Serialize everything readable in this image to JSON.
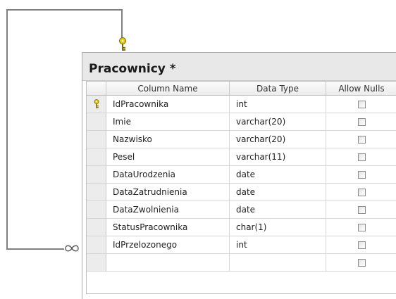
{
  "table": {
    "title": "Pracownicy *",
    "headers": {
      "name": "Column Name",
      "type": "Data Type",
      "nulls": "Allow Nulls"
    },
    "rows": [
      {
        "name": "IdPracownika",
        "type": "int",
        "allow_nulls": false,
        "primary_key": true
      },
      {
        "name": "Imie",
        "type": "varchar(20)",
        "allow_nulls": false,
        "primary_key": false
      },
      {
        "name": "Nazwisko",
        "type": "varchar(20)",
        "allow_nulls": false,
        "primary_key": false
      },
      {
        "name": "Pesel",
        "type": "varchar(11)",
        "allow_nulls": false,
        "primary_key": false
      },
      {
        "name": "DataUrodzenia",
        "type": "date",
        "allow_nulls": false,
        "primary_key": false
      },
      {
        "name": "DataZatrudnienia",
        "type": "date",
        "allow_nulls": false,
        "primary_key": false
      },
      {
        "name": "DataZwolnienia",
        "type": "date",
        "allow_nulls": false,
        "primary_key": false
      },
      {
        "name": "StatusPracownika",
        "type": "char(1)",
        "allow_nulls": false,
        "primary_key": false
      },
      {
        "name": "IdPrzelozonego",
        "type": "int",
        "allow_nulls": false,
        "primary_key": false
      },
      {
        "name": "",
        "type": "",
        "allow_nulls": false,
        "primary_key": false
      }
    ]
  },
  "icons": {
    "primary_key": "key-icon",
    "relationship_one": "key-icon",
    "relationship_many": "infinity-icon"
  },
  "colors": {
    "key_gold": "#e8c800",
    "relationship_line": "#808080"
  }
}
